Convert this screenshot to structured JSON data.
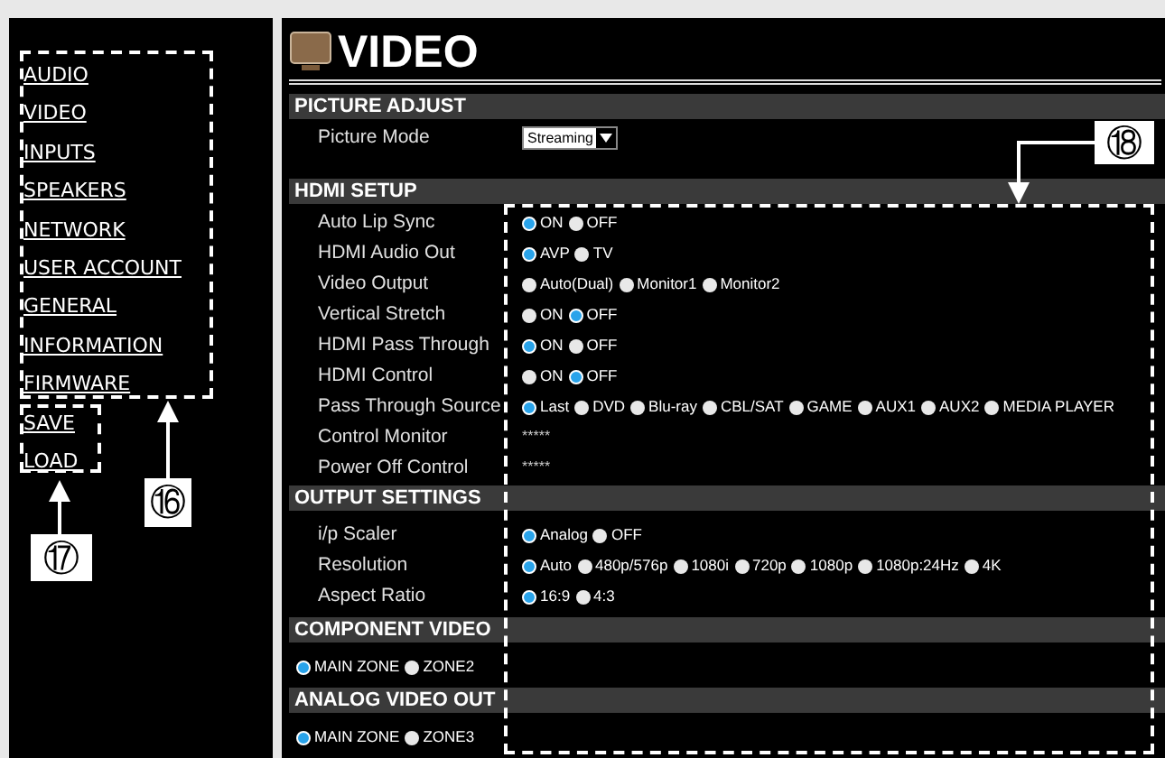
{
  "sidebar": {
    "menu": [
      {
        "label": "AUDIO"
      },
      {
        "label": "VIDEO"
      },
      {
        "label": "INPUTS"
      },
      {
        "label": "SPEAKERS"
      },
      {
        "label": "NETWORK"
      },
      {
        "label": "USER ACCOUNT"
      },
      {
        "label": "GENERAL"
      },
      {
        "label": "INFORMATION"
      },
      {
        "label": "FIRMWARE"
      }
    ],
    "actions": [
      {
        "label": "SAVE"
      },
      {
        "label": "LOAD"
      }
    ]
  },
  "page": {
    "title": "VIDEO",
    "sections": [
      {
        "title": "PICTURE ADJUST",
        "rows": [
          {
            "kind": "select",
            "label": "Picture Mode",
            "value": "Streaming"
          }
        ]
      },
      {
        "title": "HDMI SETUP",
        "rows": [
          {
            "kind": "radio",
            "label": "Auto Lip Sync",
            "options": [
              {
                "label": "ON",
                "selected": true
              },
              {
                "label": "OFF",
                "selected": false
              }
            ]
          },
          {
            "kind": "radio",
            "label": "HDMI Audio Out",
            "options": [
              {
                "label": "AVP",
                "selected": true
              },
              {
                "label": "TV",
                "selected": false
              }
            ]
          },
          {
            "kind": "radio",
            "label": "Video Output",
            "options": [
              {
                "label": "Auto(Dual)",
                "selected": false
              },
              {
                "label": "Monitor1",
                "selected": false
              },
              {
                "label": "Monitor2",
                "selected": false
              }
            ]
          },
          {
            "kind": "radio",
            "label": "Vertical Stretch",
            "options": [
              {
                "label": "ON",
                "selected": false
              },
              {
                "label": "OFF",
                "selected": true
              }
            ]
          },
          {
            "kind": "radio",
            "label": "HDMI Pass Through",
            "options": [
              {
                "label": "ON",
                "selected": true
              },
              {
                "label": "OFF",
                "selected": false
              }
            ]
          },
          {
            "kind": "radio",
            "label": "HDMI Control",
            "options": [
              {
                "label": "ON",
                "selected": false
              },
              {
                "label": "OFF",
                "selected": true
              }
            ]
          },
          {
            "kind": "radio",
            "label": "Pass Through Source",
            "options": [
              {
                "label": "Last",
                "selected": true
              },
              {
                "label": "DVD",
                "selected": false
              },
              {
                "label": "Blu-ray",
                "selected": false
              },
              {
                "label": "CBL/SAT",
                "selected": false
              },
              {
                "label": "GAME",
                "selected": false
              },
              {
                "label": "AUX1",
                "selected": false
              },
              {
                "label": "AUX2",
                "selected": false
              },
              {
                "label": "MEDIA PLAYER",
                "selected": false
              }
            ]
          },
          {
            "kind": "text",
            "label": "Control Monitor",
            "value": "*****"
          },
          {
            "kind": "text",
            "label": "Power Off Control",
            "value": "*****"
          }
        ]
      },
      {
        "title": "OUTPUT SETTINGS",
        "rows": [
          {
            "kind": "radio",
            "label": "i/p Scaler",
            "options": [
              {
                "label": "Analog",
                "selected": true
              },
              {
                "label": "OFF",
                "selected": false
              }
            ]
          },
          {
            "kind": "radio",
            "label": "Resolution",
            "options": [
              {
                "label": "Auto",
                "selected": true
              },
              {
                "label": "480p/576p",
                "selected": false
              },
              {
                "label": "1080i",
                "selected": false
              },
              {
                "label": "720p",
                "selected": false
              },
              {
                "label": "1080p",
                "selected": false
              },
              {
                "label": "1080p:24Hz",
                "selected": false
              },
              {
                "label": "4K",
                "selected": false
              }
            ]
          },
          {
            "kind": "radio",
            "label": "Aspect Ratio",
            "options": [
              {
                "label": "16:9",
                "selected": true
              },
              {
                "label": "4:3",
                "selected": false
              }
            ]
          }
        ]
      },
      {
        "title": "COMPONENT VIDEO",
        "rows": [
          {
            "kind": "radio",
            "options": [
              {
                "label": "MAIN ZONE",
                "selected": true
              },
              {
                "label": "ZONE2",
                "selected": false
              }
            ]
          }
        ]
      },
      {
        "title": "ANALOG VIDEO OUT",
        "rows": [
          {
            "kind": "radio",
            "options": [
              {
                "label": "MAIN ZONE",
                "selected": true
              },
              {
                "label": "ZONE3",
                "selected": false
              }
            ]
          }
        ]
      }
    ]
  },
  "callouts": [
    {
      "label": "⑯"
    },
    {
      "label": "⑰"
    },
    {
      "label": "⑱"
    }
  ]
}
